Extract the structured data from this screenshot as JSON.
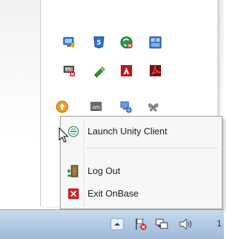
{
  "tray_overflow": {
    "icons": [
      {
        "name": "monitor-shield-icon"
      },
      {
        "name": "html5-shield-icon"
      },
      {
        "name": "green-sync-error-icon"
      },
      {
        "name": "blue-grid-app-icon"
      },
      {
        "name": "network-card-error-icon"
      },
      {
        "name": "green-usb-drive-icon"
      },
      {
        "name": "adobe-red-icon"
      },
      {
        "name": "acrobat-pdf-icon"
      },
      {
        "name": "orange-update-arrow-icon"
      },
      {
        "name": "vmware-icon"
      },
      {
        "name": "network-computer-icon"
      },
      {
        "name": "grey-butterfly-icon"
      }
    ]
  },
  "context_menu": {
    "items": [
      {
        "label": "Launch Unity Client",
        "icon": "onbase-unity-icon"
      },
      {
        "label": "Log Out",
        "icon": "door-exit-icon"
      },
      {
        "label": "Exit OnBase",
        "icon": "red-x-close-icon"
      }
    ]
  },
  "taskbar": {
    "clock_partial": "1"
  },
  "colors": {
    "taskbar_top": "#c9dcef",
    "taskbar_bottom": "#9fbad8",
    "menu_bg": "#f7f7f7",
    "exit_red": "#d6262b"
  }
}
